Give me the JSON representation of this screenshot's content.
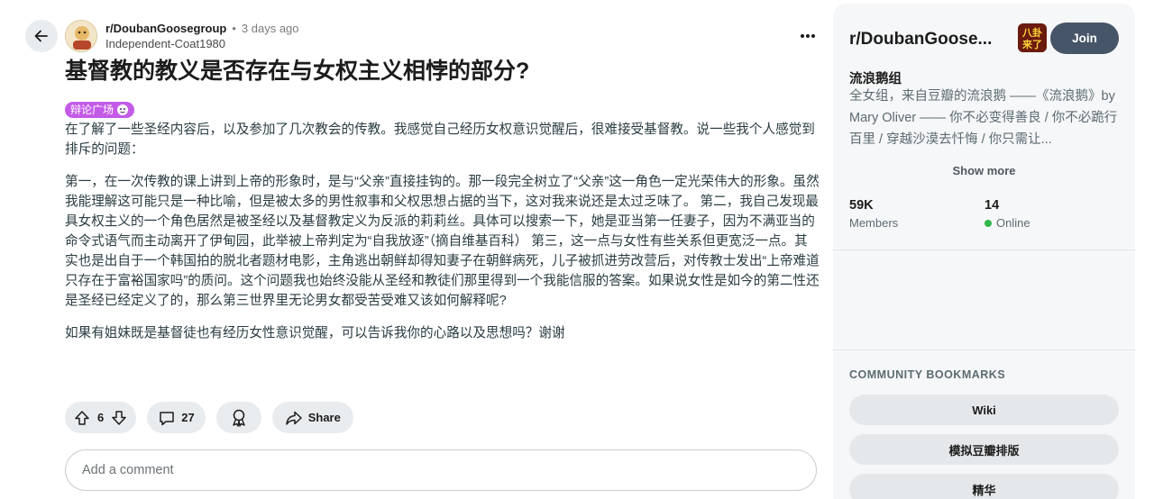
{
  "post": {
    "community": "r/DoubanGoosegroup",
    "separator": "•",
    "time_ago": "3 days ago",
    "author": "Independent-Coat1980",
    "title": "基督教的教义是否存在与女权主义相悖的部分?",
    "flair": "辩论广场",
    "paragraphs": [
      "在了解了一些圣经内容后，以及参加了几次教会的传教。我感觉自己经历女权意识觉醒后，很难接受基督教。说一些我个人感觉到排斥的问题：",
      "第一，在一次传教的课上讲到上帝的形象时，是与“父亲”直接挂钩的。那一段完全树立了“父亲”这一角色一定光荣伟大的形象。虽然我能理解这可能只是一种比喻，但是被太多的男性叙事和父权思想占据的当下，这对我来说还是太过乏味了。 第二，我自己发现最具女权主义的一个角色居然是被圣经以及基督教定义为反派的莉莉丝。具体可以搜索一下，她是亚当第一任妻子，因为不满亚当的命令式语气而主动离开了伊甸园，此举被上帝判定为“自我放逐”（摘自维基百科） 第三，这一点与女性有些关系但更宽泛一点。其实也是出自于一个韩国拍的脱北者题材电影，主角逃出朝鲜却得知妻子在朝鲜病死，儿子被抓进劳改营后，对传教士发出“上帝难道只存在于富裕国家吗”的质问。这个问题我也始终没能从圣经和教徒们那里得到一个我能信服的答案。如果说女性是如今的第二性还是圣经已经定义了的，那么第三世界里无论男女都受苦受难又该如何解释呢?",
      "如果有姐妹既是基督徒也有经历女性意识觉醒，可以告诉我你的心路以及思想吗？谢谢"
    ],
    "upvotes": "6",
    "comments": "27",
    "share_label": "Share",
    "comment_placeholder": "Add a comment"
  },
  "sidebar": {
    "name": "r/DoubanGoose...",
    "icon_text": "八卦来了",
    "join_label": "Join",
    "title": "流浪鹅组",
    "description": "全女组，来自豆瓣的流浪鹅 ——《流浪鹅》by Mary Oliver —— 你不必变得善良 / 你不必跪行百里 / 穿越沙漠去忏悔 / 你只需让...",
    "show_more": "Show more",
    "members_count": "59K",
    "members_label": "Members",
    "online_count": "14",
    "online_label": "Online",
    "bookmarks_heading": "COMMUNITY BOOKMARKS",
    "bookmarks": [
      "Wiki",
      "模拟豆瓣排版",
      "精华"
    ]
  },
  "colors": {
    "flair": "#c45be8",
    "join_button": "#475569",
    "online": "#2fb74a",
    "sidebar_bg": "#f6f7f8",
    "pill_bg": "#e9ecee"
  },
  "icons": {
    "back": "arrow-left-icon",
    "more": "ellipsis-icon",
    "upvote": "arrow-up-icon",
    "downvote": "arrow-down-icon",
    "comment": "speech-bubble-icon",
    "award": "award-icon",
    "share": "share-arrow-icon"
  }
}
